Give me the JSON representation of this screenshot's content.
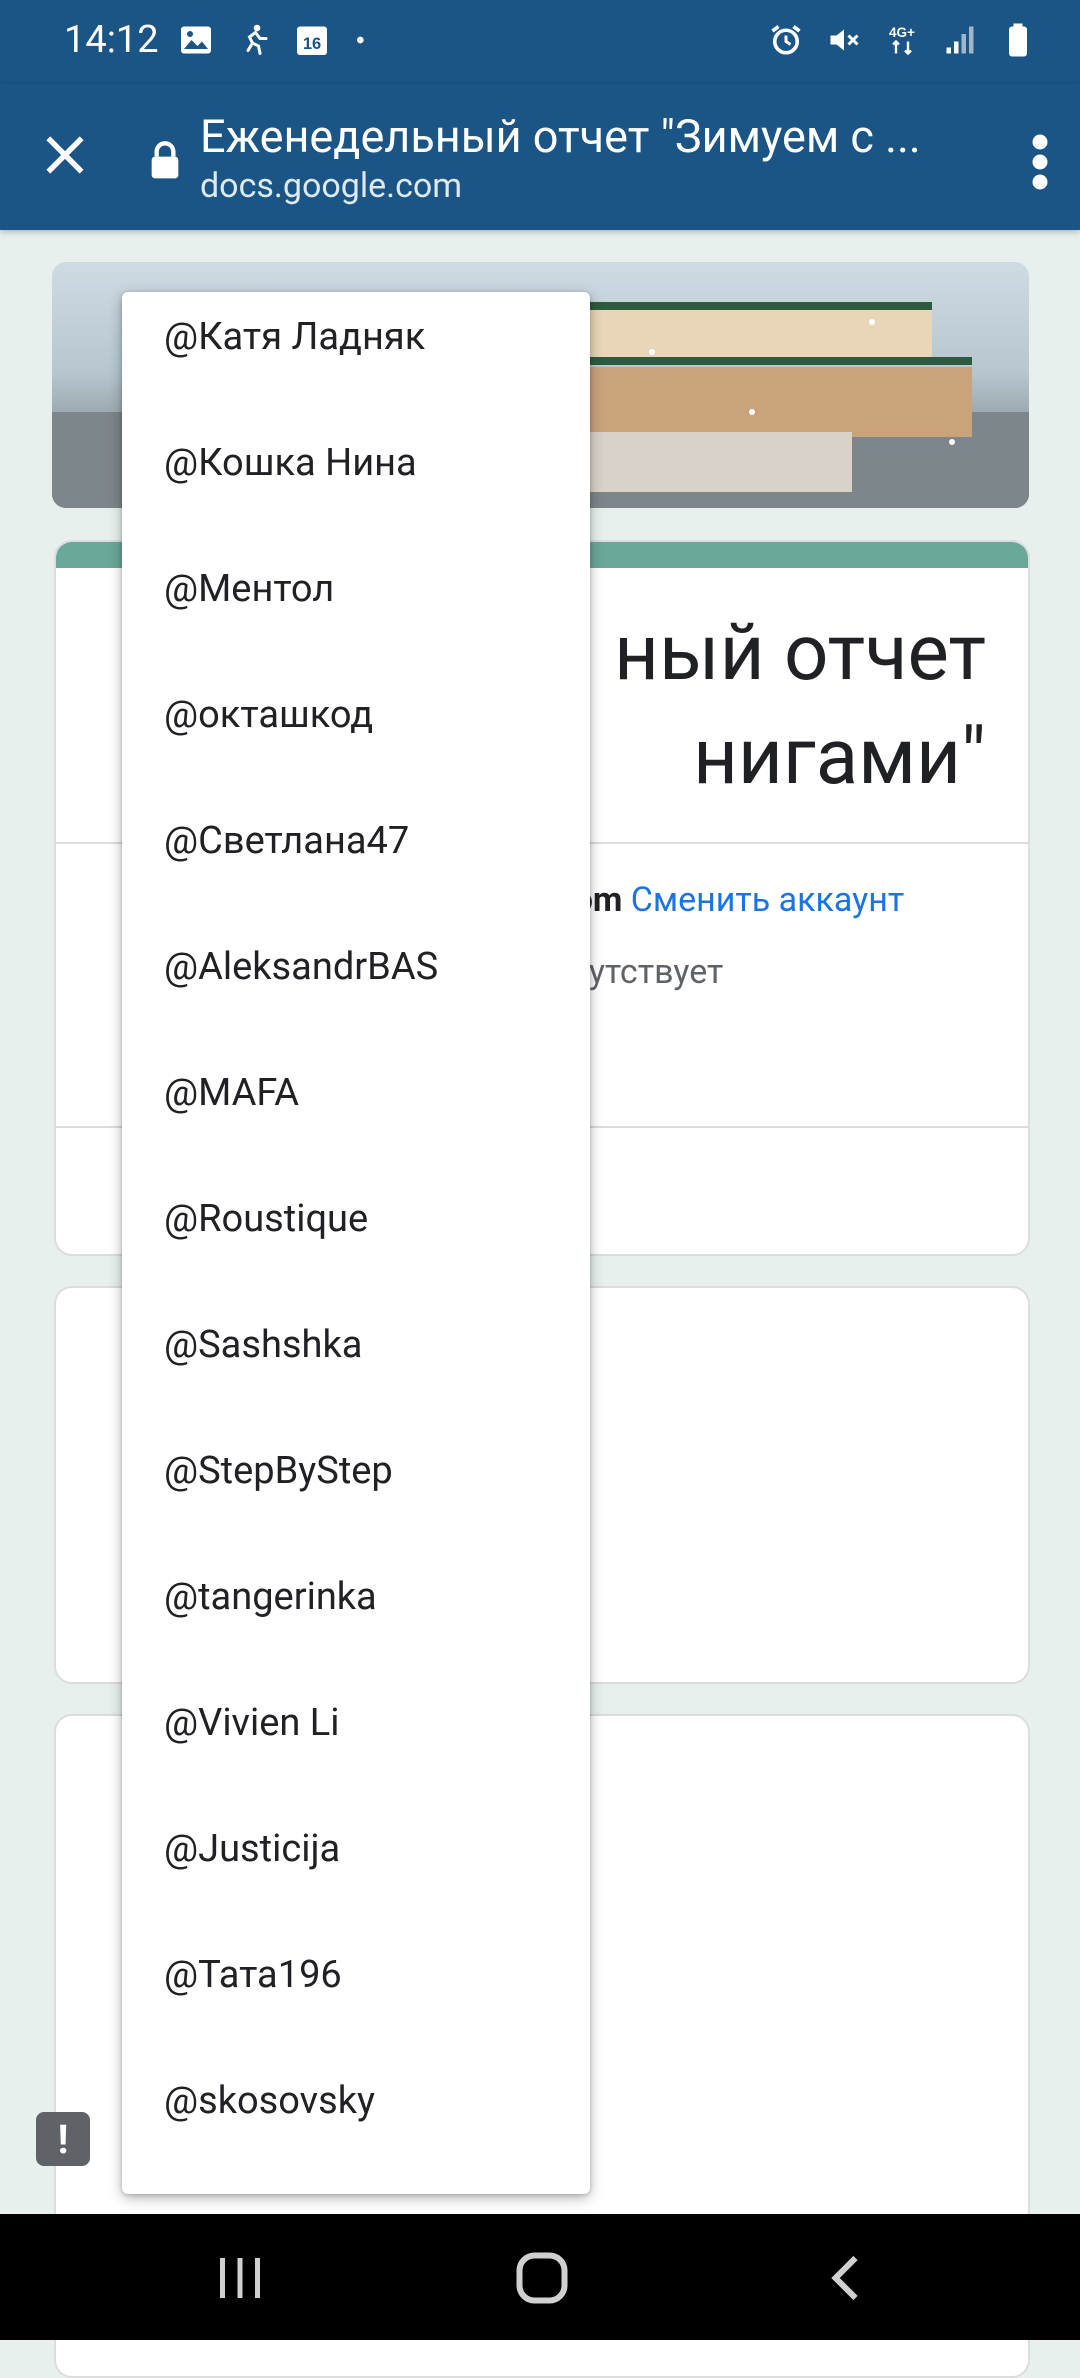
{
  "status_bar": {
    "time": "14:12",
    "calendar_day": "16",
    "network_label": "4G+",
    "icons_left": [
      "gallery-icon",
      "activity-icon",
      "calendar-icon",
      "dot-icon"
    ],
    "icons_right": [
      "alarm-icon",
      "mute-icon",
      "network-4g-icon",
      "signal-icon",
      "battery-icon"
    ]
  },
  "browser": {
    "title": "Еженедельный отчет \"Зимуем с ...",
    "domain": "docs.google.com"
  },
  "form": {
    "title_partial": "ный отчет\nнигами\"",
    "account_partial": "com",
    "switch_account": "Сменить аккаунт",
    "note_partial": "тсутствует"
  },
  "dropdown": {
    "options": [
      "@Катя Ладняк",
      "@Кошка Нина",
      "@Ментол",
      "@окташкод",
      "@Светлана47",
      "@AleksandrBAS",
      "@MAFA",
      "@Roustique",
      "@Sashshka",
      "@StepByStep",
      "@tangerinka",
      "@Vivien Li",
      "@Justicija",
      "@Тата196",
      "@skosovsky"
    ]
  },
  "feedback_glyph": "!",
  "colors": {
    "toolbar": "#1a5586",
    "accent": "#6aa89a",
    "link": "#1a73e8",
    "page_bg": "#e8f0ee"
  }
}
